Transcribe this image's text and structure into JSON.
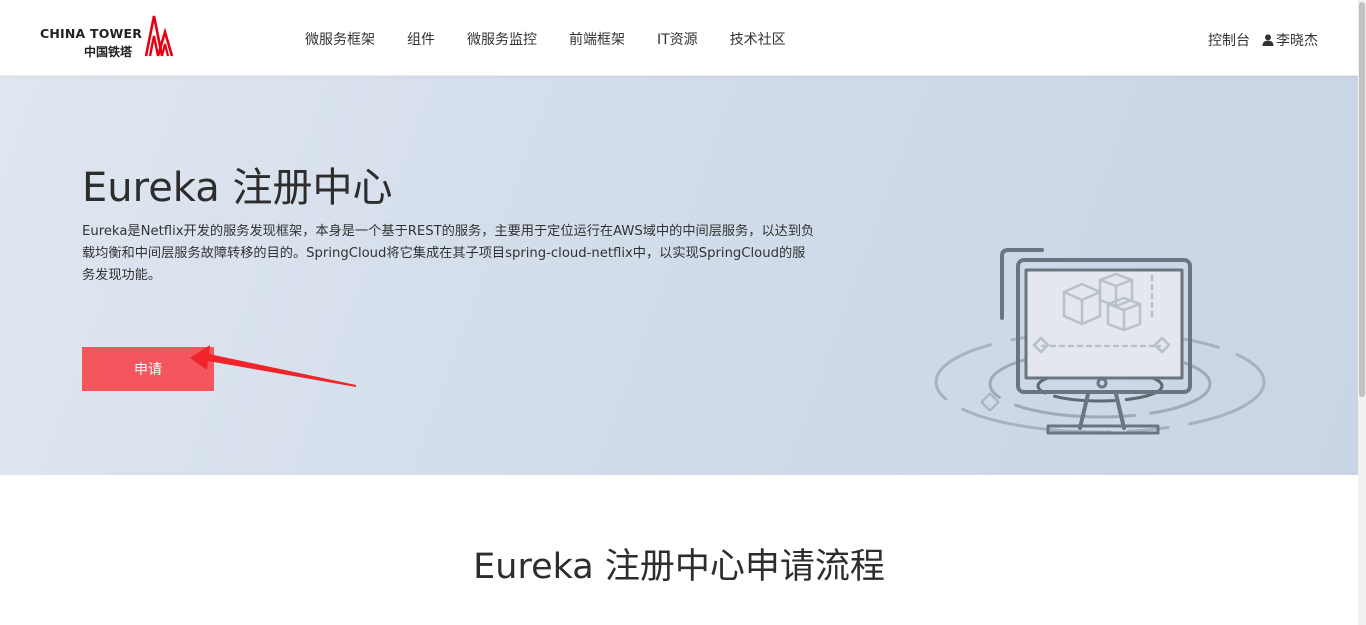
{
  "header": {
    "logo_en": "CHINA TOWER",
    "logo_cn": "中国铁塔",
    "nav": [
      "微服务框架",
      "组件",
      "微服务监控",
      "前端框架",
      "IT资源",
      "技术社区"
    ],
    "console_label": "控制台",
    "user_name": "李晓杰"
  },
  "hero": {
    "title": "Eureka 注册中心",
    "description": "Eureka是Netflix开发的服务发现框架，本身是一个基于REST的服务，主要用于定位运行在AWS域中的中间层服务，以达到负载均衡和中间层服务故障转移的目的。SpringCloud将它集成在其子项目spring-cloud-netflix中，以实现SpringCloud的服务发现功能。",
    "apply_label": "申请"
  },
  "section": {
    "title": "Eureka 注册中心申请流程"
  },
  "colors": {
    "accent": "#f3565d",
    "brand_red": "#e60012",
    "hero_bg": "#d2ddea",
    "illustration": "#6b7580"
  },
  "icons": {
    "user": "user-icon",
    "logo_mark": "tower-logo-icon",
    "illustration": "monitor-boxes-illustration",
    "annotation": "red-arrow-annotation"
  }
}
